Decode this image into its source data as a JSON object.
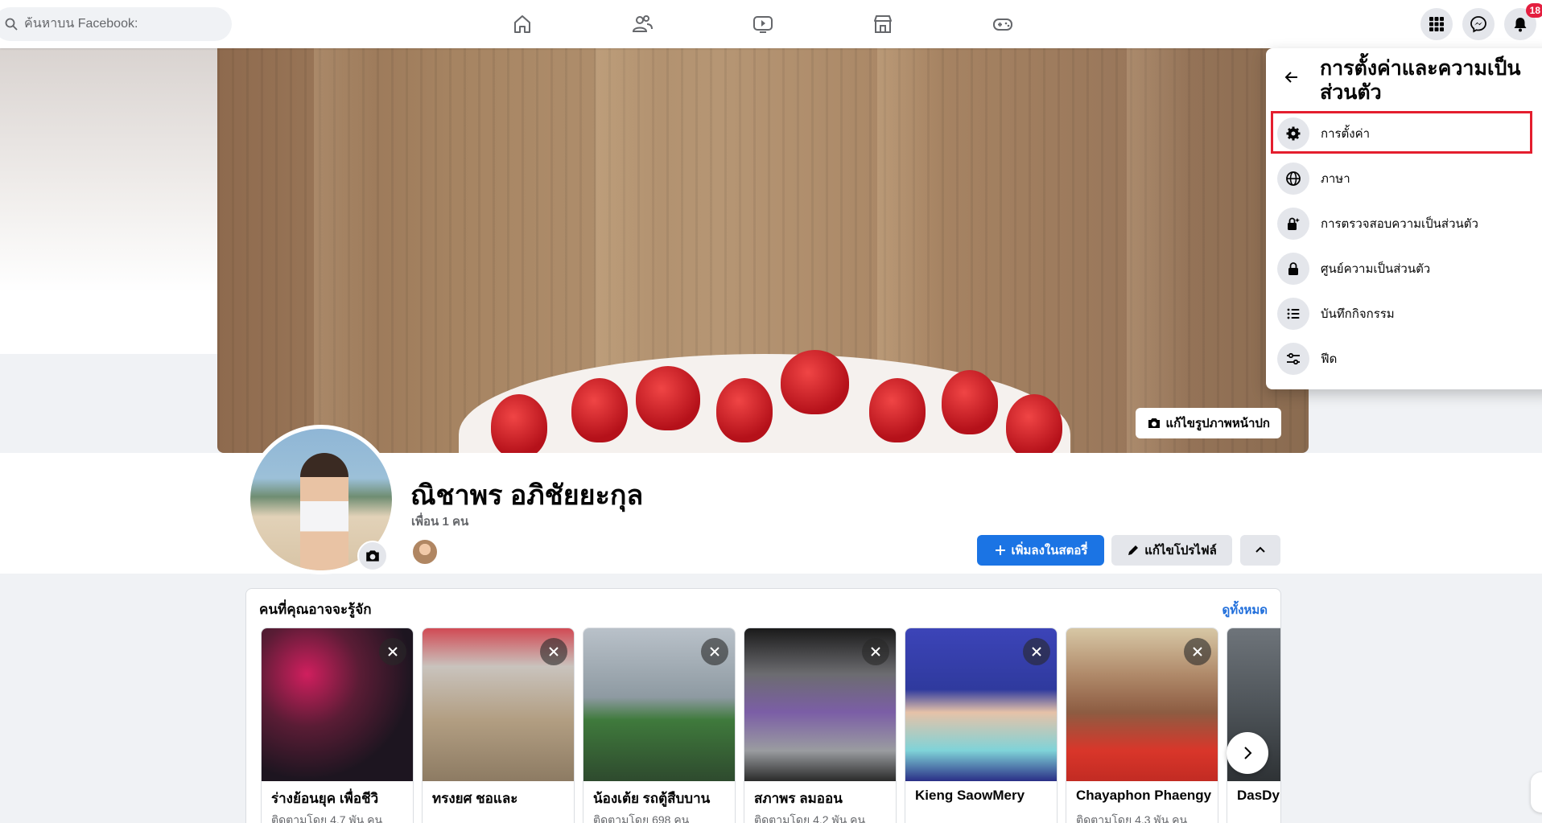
{
  "search": {
    "placeholder": "ค้นหาบน Facebook:"
  },
  "nav": {
    "icons": [
      "home-icon",
      "friends-icon",
      "watch-icon",
      "marketplace-icon",
      "gaming-icon"
    ]
  },
  "right_actions": {
    "notifications_badge": "18"
  },
  "cover": {
    "edit_label": "แก้ไขรูปภาพหน้าปก"
  },
  "profile": {
    "name": "ณิชาพร อภิชัยยะกุล",
    "friends": "เพื่อน 1 คน",
    "add_story_label": "เพิ่มลงในสตอรี่",
    "edit_profile_label": "แก้ไขโปรไฟล์"
  },
  "pymk": {
    "title": "คนที่คุณอาจจะรู้จัก",
    "see_all": "ดูทั้งหมด",
    "people": [
      {
        "name": "ร่างย้อนยุค เพื่อชีวิ",
        "followers": "ติดตามโดย 4.7 พัน คน"
      },
      {
        "name": "ทรงยศ ชอและ",
        "followers": ""
      },
      {
        "name": "น้องเต้ย รถตู้สืบบาน",
        "followers": "ติดตามโดย 698 คน"
      },
      {
        "name": "สภาพร ลมออน",
        "followers": "ติดตามโดย 4.2 พัน คน"
      },
      {
        "name": "Kieng SaowMery",
        "followers": ""
      },
      {
        "name": "Chayaphon Phaengy",
        "followers": "ติดตามโดย 4.3 พัน คน"
      },
      {
        "name": "DasDy",
        "followers": ""
      }
    ]
  },
  "menu": {
    "title": "การตั้งค่าและความเป็นส่วนตัว",
    "items": [
      {
        "label": "การตั้งค่า",
        "icon": "gear-icon"
      },
      {
        "label": "ภาษา",
        "icon": "globe-icon"
      },
      {
        "label": "การตรวจสอบความเป็นส่วนตัว",
        "icon": "lock-check-icon"
      },
      {
        "label": "ศูนย์ความเป็นส่วนตัว",
        "icon": "lock-icon"
      },
      {
        "label": "บันทึกกิจกรรม",
        "icon": "list-icon"
      },
      {
        "label": "ฟีด",
        "icon": "sliders-icon"
      }
    ]
  },
  "colors": {
    "primary": "#1b74e4",
    "link": "#216fdb",
    "highlight": "#e41e2e",
    "badge": "#e41e3f"
  }
}
